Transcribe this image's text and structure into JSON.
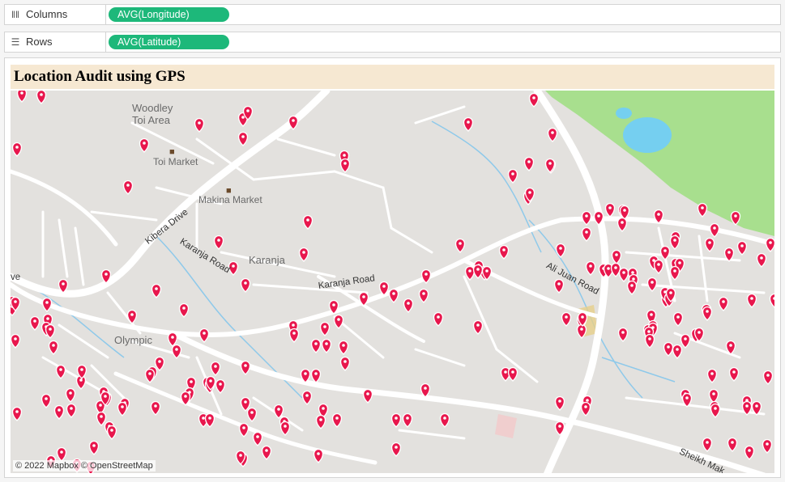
{
  "shelves": {
    "columns": {
      "label": "Columns",
      "icon": "columns-icon",
      "pill": "AVG(Longitude)"
    },
    "rows": {
      "label": "Rows",
      "icon": "rows-icon",
      "pill": "AVG(Latitude)"
    }
  },
  "pill_color": "#1db87a",
  "title": "Location Audit using GPS",
  "title_bg": "#f6e8d2",
  "map": {
    "marker_color": "#e8174d",
    "park_color": "#a8df8e",
    "water_color": "#75cff0",
    "labels": {
      "woodley": "Woodley",
      "toi_area": "Toi Area",
      "toi_market": "Toi Market",
      "makina_market": "Makina Market",
      "karanja": "Karanja",
      "olympic": "Olympic",
      "kibera_drive": "Kibera Drive",
      "karanja_road_1": "Karanja Road",
      "karanja_road_2": "Karanja Road",
      "ali_juan_road": "Ali Juan Road",
      "sheikh": "Sheikh Mak",
      "ve": "ve"
    },
    "attribution": "© 2022 Mapbox © OpenStreetMap"
  }
}
